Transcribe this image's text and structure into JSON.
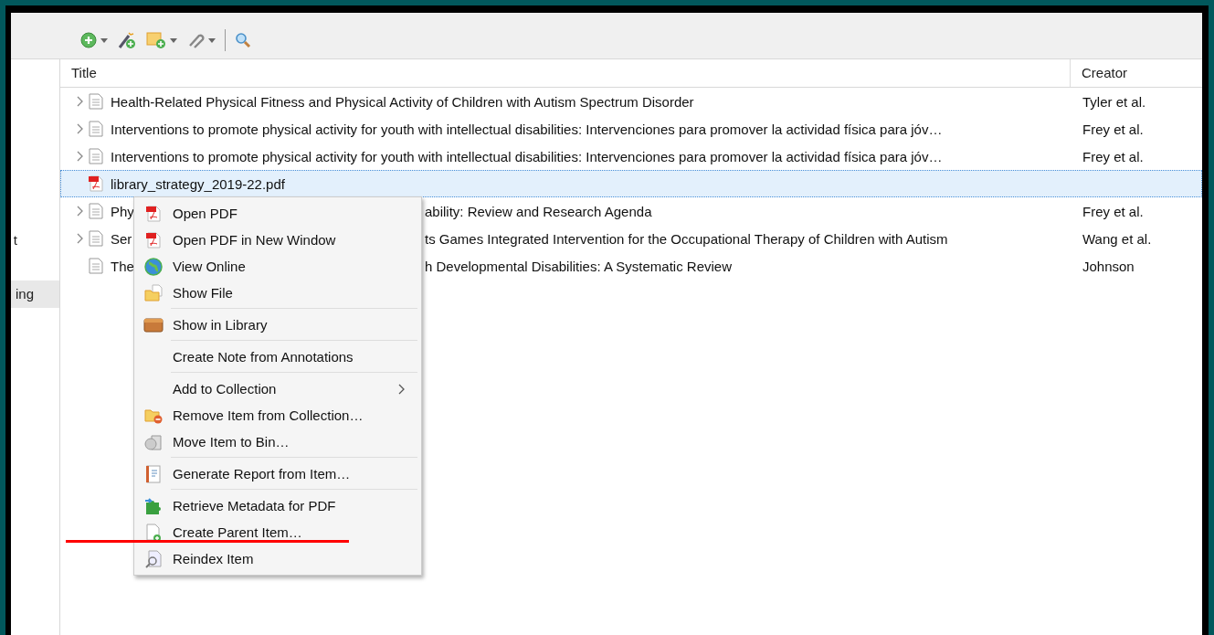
{
  "toolbar": {
    "buttons": [
      {
        "kind": "new-item"
      },
      {
        "kind": "wand"
      },
      {
        "kind": "new-note"
      },
      {
        "kind": "attach"
      },
      {
        "kind": "separator"
      },
      {
        "kind": "search"
      }
    ]
  },
  "sidebar": {
    "items": [
      {
        "label": "t",
        "selected": false
      },
      {
        "label": "ing",
        "selected": true
      }
    ]
  },
  "table": {
    "columns": [
      "Title",
      "Creator"
    ],
    "rows": [
      {
        "kind": "item",
        "expandable": true,
        "selected": false,
        "title": [
          "Health-Related Physical Fitness and Physical Activity of Children with Autism Spectrum Disorder"
        ],
        "creator": "Tyler et al."
      },
      {
        "kind": "item",
        "expandable": true,
        "selected": false,
        "title": [
          "Interventions to promote physical activity for youth with intellectual disabilities: Intervenciones para promover la actividad física para jóv…"
        ],
        "creator": "Frey et al."
      },
      {
        "kind": "item",
        "expandable": true,
        "selected": false,
        "title": [
          "Interventions to promote physical activity for youth with intellectual disabilities: Intervenciones para promover la actividad física para jóv…"
        ],
        "creator": "Frey et al."
      },
      {
        "kind": "attachment",
        "expandable": false,
        "selected": true,
        "title": [
          "library_strategy_2019-22.pdf"
        ]
      },
      {
        "kind": "item",
        "expandable": true,
        "selected": false,
        "title": [
          "Phy",
          "ability: Review and Research Agenda"
        ],
        "creator": "Frey et al."
      },
      {
        "kind": "item",
        "expandable": true,
        "selected": false,
        "title": [
          "Ser",
          "ts Games Integrated Intervention for the Occupational Therapy of Children with Autism"
        ],
        "creator": "Wang et al."
      },
      {
        "kind": "item",
        "expandable": false,
        "selected": false,
        "title": [
          "The",
          "h Developmental Disabilities: A Systematic Review"
        ],
        "creator": "Johnson"
      }
    ]
  },
  "context_menu": {
    "groups": [
      [
        {
          "label": "Open PDF",
          "submenu": false
        },
        {
          "label": "Open PDF in New Window",
          "submenu": false
        },
        {
          "label": "View Online",
          "submenu": false
        },
        {
          "label": "Show File",
          "submenu": false
        }
      ],
      [
        {
          "label": "Show in Library",
          "submenu": false
        }
      ],
      [
        {
          "label": "Create Note from Annotations",
          "submenu": false
        }
      ],
      [
        {
          "label": "Add to Collection",
          "submenu": true
        },
        {
          "label": "Remove Item from Collection…",
          "submenu": false
        },
        {
          "label": "Move Item to Bin…",
          "submenu": false
        }
      ],
      [
        {
          "label": "Generate Report from Item…",
          "submenu": false
        }
      ],
      [
        {
          "label": "Retrieve Metadata for PDF",
          "submenu": false
        },
        {
          "label": "Create Parent Item…",
          "submenu": false
        },
        {
          "label": "Reindex Item",
          "submenu": false
        }
      ]
    ]
  },
  "annotation": {
    "kind": "underline"
  }
}
